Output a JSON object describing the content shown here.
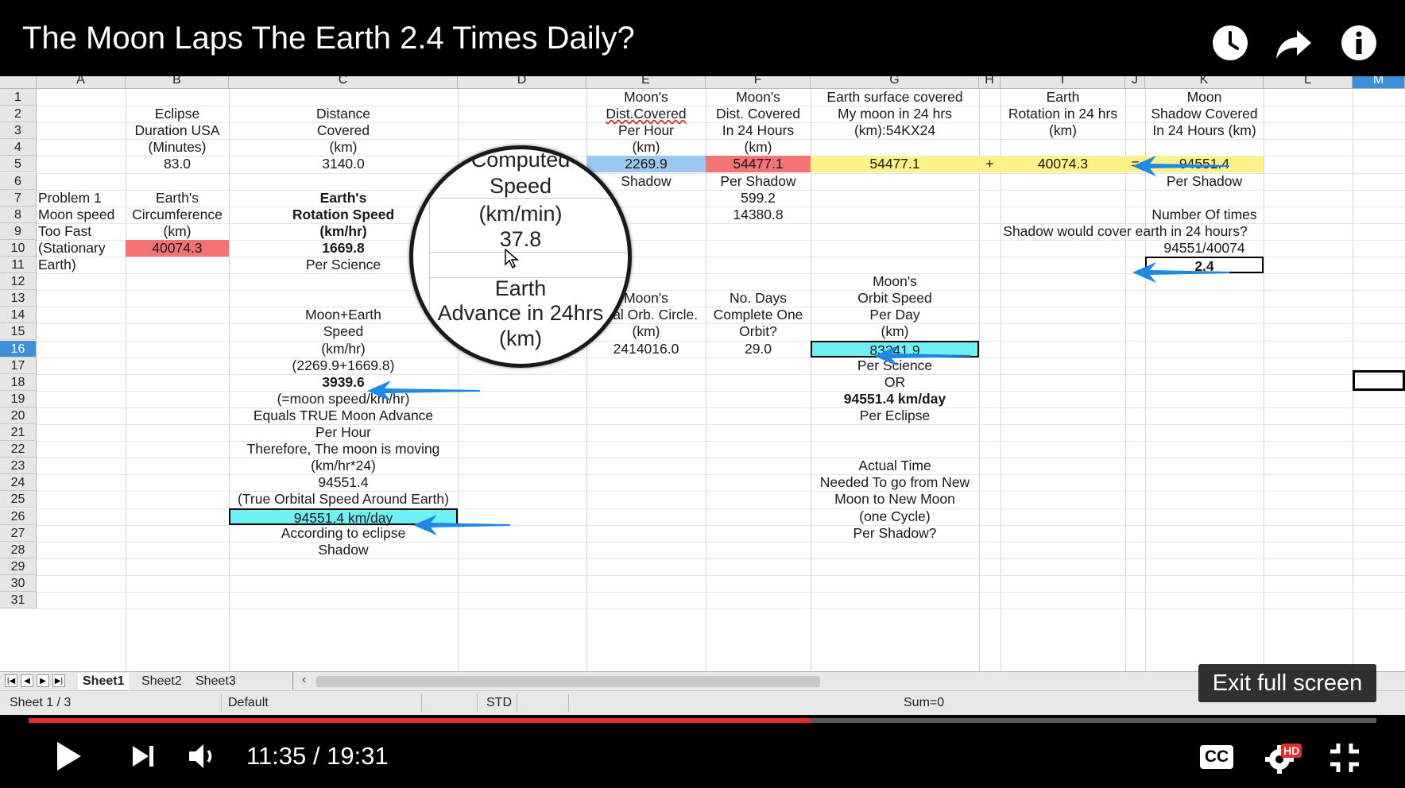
{
  "video": {
    "title": "The Moon Laps The Earth 2.4 Times Daily?",
    "time_current": "11:35",
    "time_separator": "/",
    "time_total": "19:31",
    "progress_fraction": 0.58,
    "exit_fullscreen_label": "Exit full screen",
    "hd_badge": "HD",
    "cc_label": "CC"
  },
  "spreadsheet": {
    "columns": [
      "A",
      "B",
      "C",
      "D",
      "E",
      "F",
      "G",
      "H",
      "I",
      "J",
      "K",
      "L",
      "M"
    ],
    "rows": [
      "1",
      "2",
      "3",
      "4",
      "5",
      "6",
      "7",
      "8",
      "9",
      "10",
      "11",
      "12",
      "13",
      "14",
      "15",
      "16",
      "17",
      "18",
      "19",
      "20",
      "21",
      "22",
      "23",
      "24",
      "25",
      "26",
      "27",
      "28",
      "29",
      "30",
      "31"
    ],
    "active_row": "16",
    "cells": {
      "E1": "Moon's",
      "F1": "Moon's",
      "G1": "Earth surface covered",
      "I1": "Earth",
      "K1": "Moon",
      "B2": "Eclipse",
      "C2": "Distance",
      "E2": "Dist.Covered",
      "F2": "Dist. Covered",
      "G2": "My moon in 24 hrs",
      "I2": "Rotation in 24 hrs",
      "K2": "Shadow Covered",
      "B3": "Duration USA",
      "C3": "Covered",
      "E3": "Per Hour",
      "F3": "In 24 Hours",
      "G3": "(km):54KX24",
      "I3": "(km)",
      "K3": "In 24 Hours (km)",
      "B4": "(Minutes)",
      "C4": "(km)",
      "E4": "(km)",
      "F4": "(km)",
      "B5": "83.0",
      "C5": "3140.0",
      "E5": "2269.9",
      "F5": "54477.1",
      "G5": "54477.1",
      "H5": "+",
      "I5": "40074.3",
      "J5": "=",
      "K5": "94551.4",
      "E6": "Shadow",
      "F6": "Per Shadow",
      "K6": "Per Shadow",
      "A7": "Problem 1",
      "B7": "Earth's",
      "C7": "Earth's",
      "F7": "599.2",
      "A8": "Moon speed",
      "B8": "Circumference",
      "C8": "Rotation Speed",
      "F8": "14380.8",
      "K8": "Number Of times",
      "A9": "Too Fast",
      "B9": "(km)",
      "C9": "(km/hr)",
      "K9": "Shadow would cover earth in 24 hours?",
      "A10": "(Stationary",
      "B10": "40074.3",
      "C10": "1669.8",
      "K10": "94551/40074",
      "A11": "Earth)",
      "C11": "Per Science",
      "D11": "Per Science",
      "K11": "2.4",
      "G12": "Moon's",
      "E13": "Moon's",
      "F13": "No. Days",
      "G13": "Orbit Speed",
      "C14": "Moon+Earth",
      "E14": "Total Orb. Circle.",
      "F14": "Complete One",
      "G14": "Per Day",
      "C15": "Speed",
      "E15": "(km)",
      "F15": "Orbit?",
      "G15": "(km)",
      "C16": "(km/hr)",
      "E16": "2414016.0",
      "F16": "29.0",
      "G16": "83241.9",
      "C17": "(2269.9+1669.8)",
      "G17": "Per Science",
      "C18": "3939.6",
      "G18": "OR",
      "C19": "(=moon speed/km/hr)",
      "G19": "94551.4 km/day",
      "C20": "Equals TRUE Moon Advance",
      "G20": "Per Eclipse",
      "C21": "Per Hour",
      "C22": "Therefore, The moon is moving",
      "C23": "(km/hr*24)",
      "G23": "Actual Time",
      "C24": "94551.4",
      "G24": "Needed To go from New",
      "C25": "(True Orbital Speed Around Earth)",
      "G25": "Moon to New Moon",
      "C26": "94551.4 km/day",
      "G26": "(one Cycle)",
      "C27": "According to eclipse",
      "G27": "Per Shadow?",
      "C28": "Shadow"
    },
    "magnifier": {
      "header": "Computed",
      "line1": "Speed",
      "line2": "(km/min)",
      "value": "37.8",
      "line3": "Earth",
      "line4": "Advance in 24hrs",
      "line5": "(km)"
    },
    "sheet_tabs": [
      "Sheet1",
      "Sheet2",
      "Sheet3"
    ],
    "active_tab": "Sheet1",
    "status": {
      "sheet_info": "Sheet 1 / 3",
      "page_style": "Default",
      "mode": "STD",
      "sum": "Sum=0"
    },
    "colors": {
      "red_fill": "#f47373",
      "yellow_fill": "#fbf38a",
      "cyan_fill": "#6ff0f5",
      "arrow_blue": "#1e88e5",
      "progress_red": "#e52d27"
    }
  }
}
